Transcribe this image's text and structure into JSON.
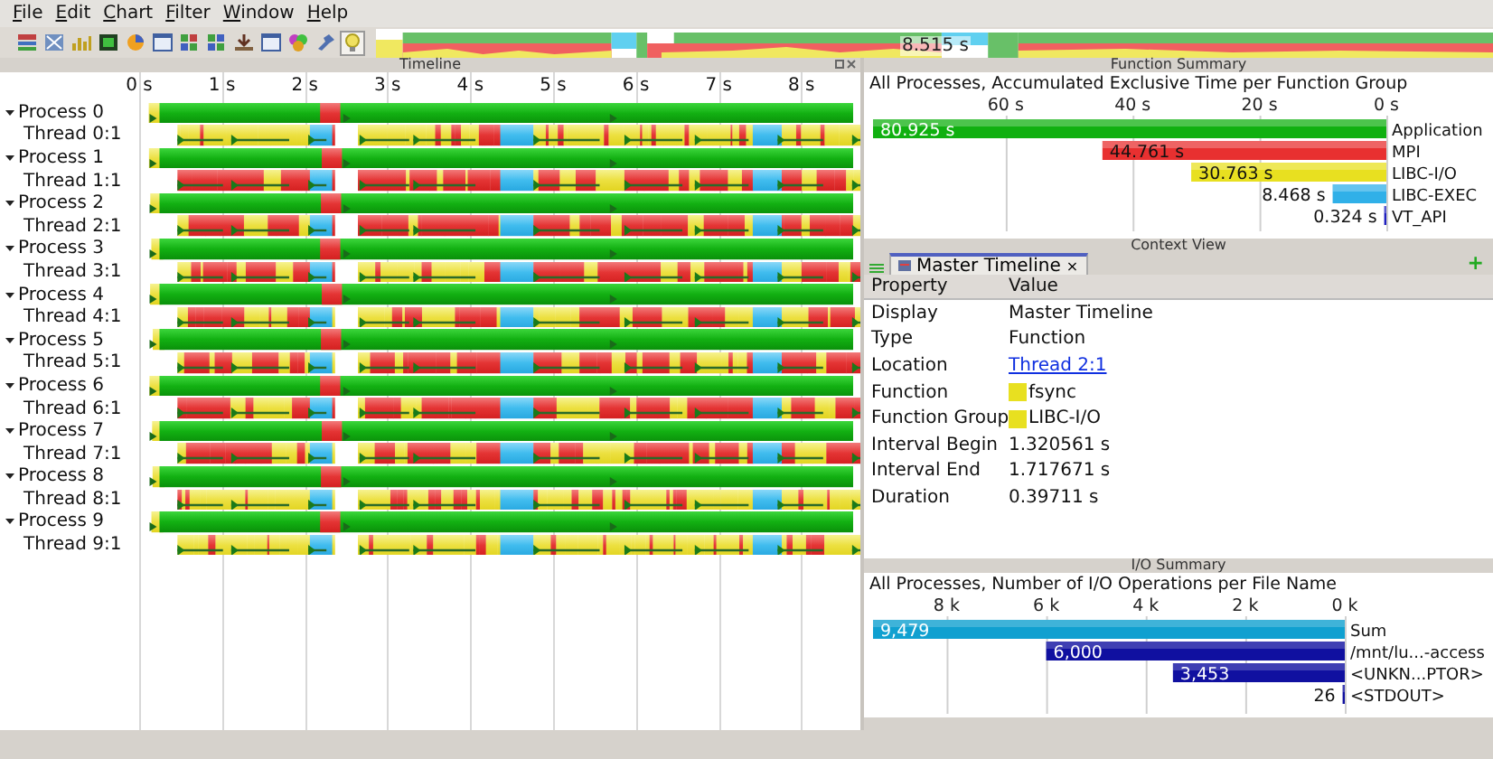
{
  "menu": [
    "File",
    "Edit",
    "Chart",
    "Filter",
    "Window",
    "Help"
  ],
  "toolbar": {
    "buttons": [
      {
        "on": false
      },
      {
        "on": false
      },
      {
        "on": false
      },
      {
        "on": false
      },
      {
        "on": false
      },
      {
        "on": false
      },
      {
        "on": false
      },
      {
        "on": false
      },
      {
        "on": false
      },
      {
        "on": false
      },
      {
        "on": false
      },
      {
        "on": false
      },
      {
        "on": true
      }
    ]
  },
  "overview": {
    "time": "8.515 s"
  },
  "timeline": {
    "title": "Timeline",
    "axis_labels": [
      "0 s",
      "1 s",
      "2 s",
      "3 s",
      "4 s",
      "5 s",
      "6 s",
      "7 s",
      "8 s"
    ],
    "rows": [
      {
        "kind": "process",
        "label": "Process 0",
        "expanded": true
      },
      {
        "kind": "thread",
        "label": "Thread 0:1"
      },
      {
        "kind": "process",
        "label": "Process 1",
        "expanded": true
      },
      {
        "kind": "thread",
        "label": "Thread 1:1"
      },
      {
        "kind": "process",
        "label": "Process 2",
        "expanded": true
      },
      {
        "kind": "thread",
        "label": "Thread 2:1"
      },
      {
        "kind": "process",
        "label": "Process 3",
        "expanded": true
      },
      {
        "kind": "thread",
        "label": "Thread 3:1"
      },
      {
        "kind": "process",
        "label": "Process 4",
        "expanded": true
      },
      {
        "kind": "thread",
        "label": "Thread 4:1"
      },
      {
        "kind": "process",
        "label": "Process 5",
        "expanded": true
      },
      {
        "kind": "thread",
        "label": "Thread 5:1"
      },
      {
        "kind": "process",
        "label": "Process 6",
        "expanded": true
      },
      {
        "kind": "thread",
        "label": "Thread 6:1"
      },
      {
        "kind": "process",
        "label": "Process 7",
        "expanded": true
      },
      {
        "kind": "thread",
        "label": "Thread 7:1"
      },
      {
        "kind": "process",
        "label": "Process 8",
        "expanded": true
      },
      {
        "kind": "thread",
        "label": "Thread 8:1"
      },
      {
        "kind": "process",
        "label": "Process 9",
        "expanded": true
      },
      {
        "kind": "thread",
        "label": "Thread 9:1"
      }
    ]
  },
  "function_summary": {
    "title": "Function Summary",
    "chart_data": {
      "type": "bar",
      "orientation": "horizontal",
      "grid": true,
      "title": "All Processes, Accumulated Exclusive Time per Function Group",
      "series": [
        {
          "name": "Application",
          "color": "#10b010",
          "values": [
            80.925
          ]
        },
        {
          "name": "MPI",
          "color": "#e83030",
          "values": [
            44.761
          ]
        },
        {
          "name": "LIBC-I/O",
          "color": "#e8e020",
          "values": [
            30.763
          ]
        },
        {
          "name": "LIBC-EXEC",
          "color": "#30b0e8",
          "values": [
            8.468
          ]
        },
        {
          "name": "VT_API",
          "color": "#2020c0",
          "values": [
            0.324
          ]
        }
      ],
      "xlim": [
        80.925,
        0
      ],
      "xticks": [
        {
          "value": 60,
          "label": "60 s"
        },
        {
          "value": 40,
          "label": "40 s"
        },
        {
          "value": 20,
          "label": "20 s"
        },
        {
          "value": 0,
          "label": "0 s"
        }
      ],
      "value_labels": [
        "80.925 s",
        "44.761 s",
        "30.763 s",
        "8.468 s",
        "0.324 s"
      ]
    }
  },
  "context_view": {
    "title": "Context View",
    "tab": {
      "label": "Master Timeline",
      "close": "×",
      "selected": true
    },
    "add": "+",
    "columns": [
      "Property",
      "Value"
    ],
    "rows": [
      {
        "property": "Display",
        "kind": "text",
        "value": "Master Timeline"
      },
      {
        "property": "Type",
        "kind": "text",
        "value": "Function"
      },
      {
        "property": "Location",
        "kind": "link",
        "value": "Thread 2:1"
      },
      {
        "property": "Function",
        "kind": "swatch",
        "color": "#e8e020",
        "value": "fsync"
      },
      {
        "property": "Function Group",
        "kind": "swatch",
        "color": "#e8e020",
        "value": "LIBC-I/O"
      },
      {
        "property": "Interval Begin",
        "kind": "text",
        "value": "1.320561 s"
      },
      {
        "property": "Interval End",
        "kind": "text",
        "value": "1.717671 s"
      },
      {
        "property": "Duration",
        "kind": "text",
        "value": "0.39711 s"
      }
    ]
  },
  "io_summary": {
    "title": "I/O Summary",
    "chart_data": {
      "type": "bar",
      "orientation": "horizontal",
      "grid": true,
      "title": "All Processes, Number of I/O Operations per File Name",
      "series": [
        {
          "name": "Sum",
          "color": "#10a0d0",
          "values": [
            9479
          ]
        },
        {
          "name": "/mnt/lu...-access",
          "color": "#1010a0",
          "values": [
            6000
          ]
        },
        {
          "name": "<UNKN...PTOR>",
          "color": "#1010a0",
          "values": [
            3453
          ]
        },
        {
          "name": "<STDOUT>",
          "color": "#1010a0",
          "values": [
            26
          ]
        }
      ],
      "xlim": [
        9479,
        0
      ],
      "xticks": [
        {
          "value": 8000,
          "label": "8 k"
        },
        {
          "value": 6000,
          "label": "6 k"
        },
        {
          "value": 4000,
          "label": "4 k"
        },
        {
          "value": 2000,
          "label": "2 k"
        },
        {
          "value": 0,
          "label": "0 k"
        }
      ],
      "value_labels": [
        "9,479",
        "6,000",
        "3,453",
        "26"
      ]
    }
  }
}
